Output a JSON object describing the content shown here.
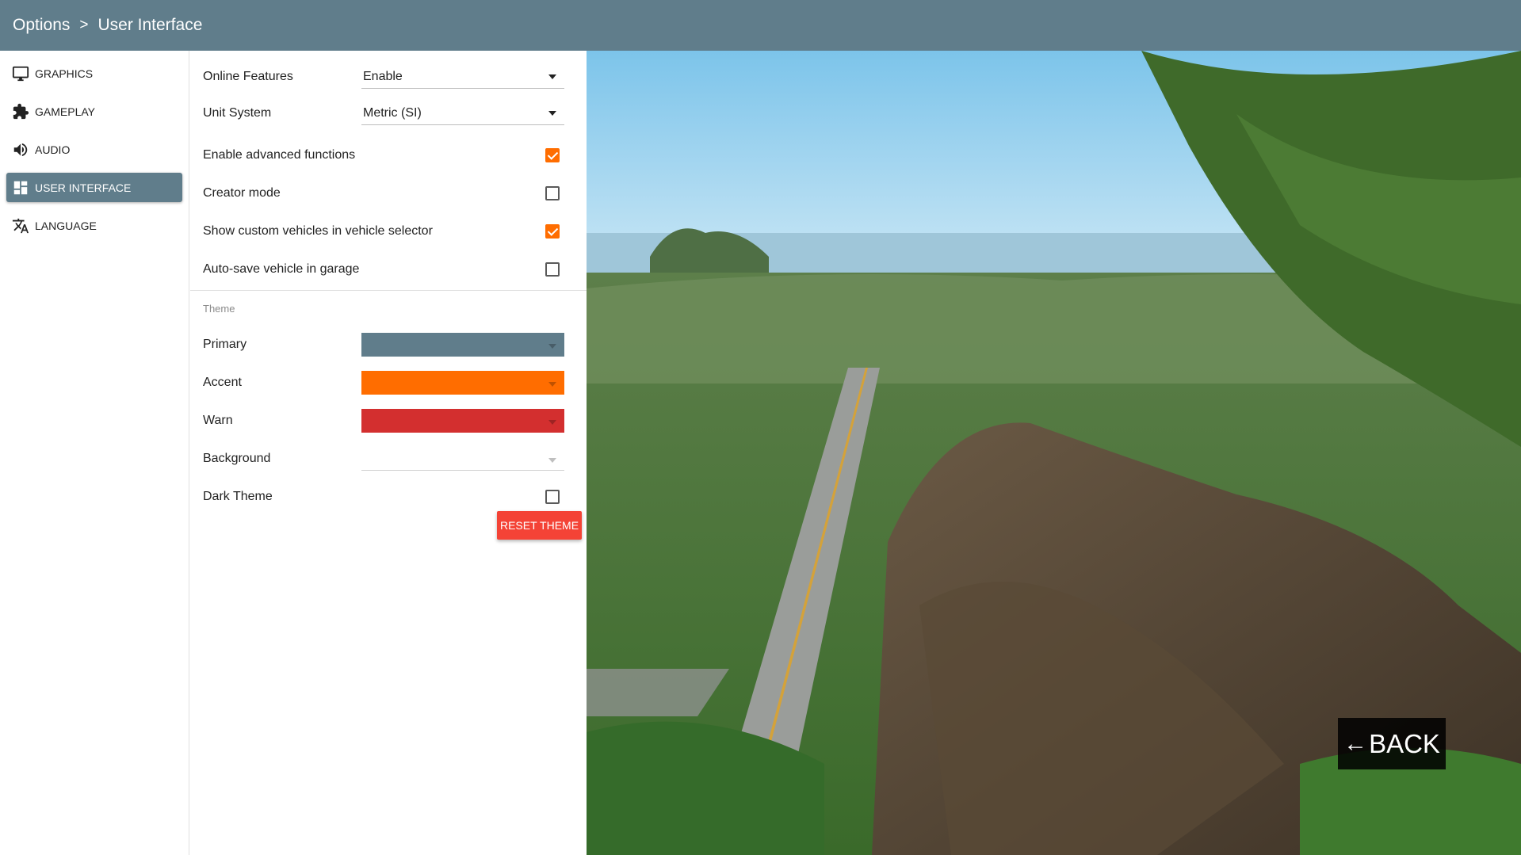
{
  "header": {
    "crumb_root": "Options",
    "separator": ">",
    "crumb_current": "User Interface"
  },
  "sidebar": {
    "items": [
      {
        "label": "GRAPHICS",
        "icon": "monitor-icon"
      },
      {
        "label": "GAMEPLAY",
        "icon": "puzzle-icon"
      },
      {
        "label": "AUDIO",
        "icon": "speaker-icon"
      },
      {
        "label": "USER INTERFACE",
        "icon": "dashboard-icon",
        "active": true
      },
      {
        "label": "LANGUAGE",
        "icon": "translate-icon"
      }
    ]
  },
  "settings": {
    "online_features": {
      "label": "Online Features",
      "value": "Enable"
    },
    "unit_system": {
      "label": "Unit System",
      "value": "Metric (SI)"
    },
    "advanced_functions": {
      "label": "Enable advanced functions",
      "checked": true
    },
    "creator_mode": {
      "label": "Creator mode",
      "checked": false
    },
    "custom_vehicles": {
      "label": "Show custom vehicles in vehicle selector",
      "checked": true
    },
    "auto_save": {
      "label": "Auto-save vehicle in garage",
      "checked": false
    }
  },
  "theme": {
    "header": "Theme",
    "primary": {
      "label": "Primary",
      "color": "#607d8b"
    },
    "accent": {
      "label": "Accent",
      "color": "#ff6d00"
    },
    "warn": {
      "label": "Warn",
      "color": "#d32f2f"
    },
    "background": {
      "label": "Background",
      "color": ""
    },
    "dark_theme": {
      "label": "Dark Theme",
      "checked": false
    },
    "reset_label": "RESET THEME"
  },
  "back_button": {
    "arrow": "←",
    "label": "BACK"
  }
}
